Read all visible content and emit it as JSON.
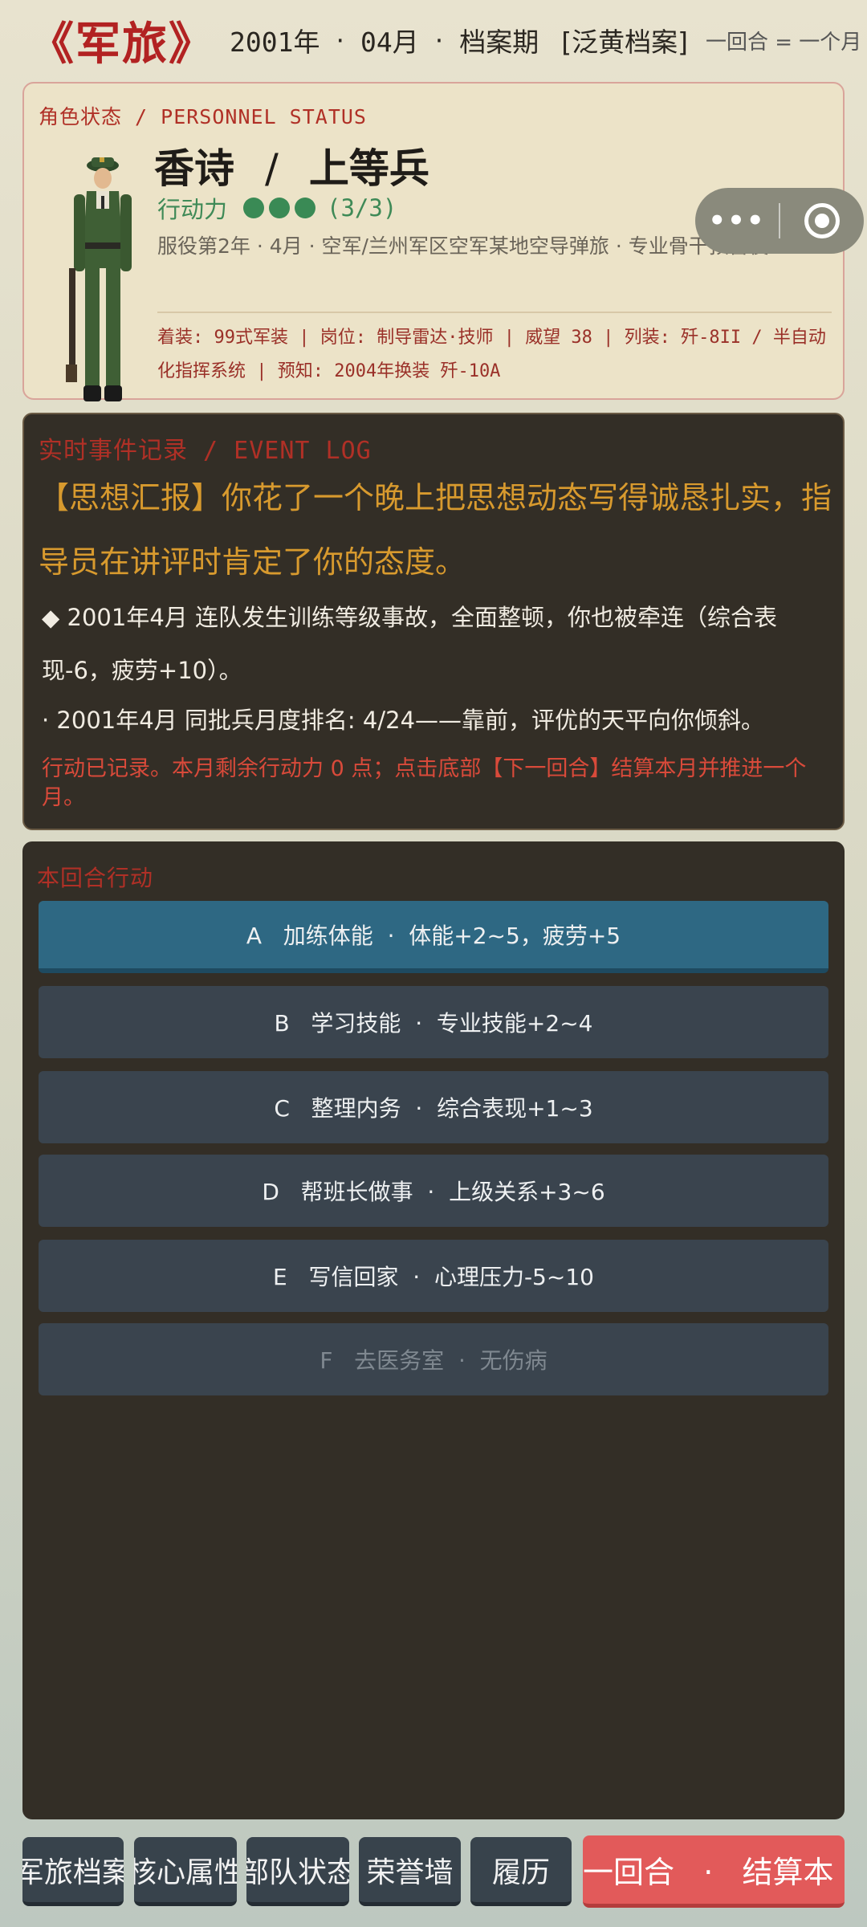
{
  "header": {
    "logo": "《军旅》",
    "year": "2001年",
    "month": "04月",
    "period": "档案期",
    "tag": "[泛黄档案]",
    "note": "一回合 = 一个月"
  },
  "status": {
    "section_title": "角色状态 / PERSONNEL STATUS",
    "name": "香诗",
    "rank": "上等兵",
    "ap_label": "行动力",
    "ap_count": "(3/3)",
    "ap_value": 3,
    "ap_max": 3,
    "service": "服役第2年 · 4月 · 空军/兰州军区空军某地空导弹旅 · 专业骨干预备役",
    "equipment": "着装: 99式军装 | 岗位: 制导雷达·技师 | 威望 38 | 列装: 歼-8II / 半自动化指挥系统 | 预知: 2004年换装 歼-10A",
    "colors": {
      "accent": "#b03026",
      "ap": "#3a8a55"
    }
  },
  "event_log": {
    "section_title": "实时事件记录 / EVENT LOG",
    "main": "【思想汇报】你花了一个晚上把思想动态写得诚恳扎实，指导员在讲评时肯定了你的态度。",
    "line1": "◆ 2001年4月 连队发生训练等级事故，全面整顿，你也被牵连（综合表现-6，疲劳+10）。",
    "line2": "· 2001年4月 同批兵月度排名: 4/24——靠前，评优的天平向你倾斜。",
    "note": "行动已记录。本月剩余行动力 0 点；点击底部【下一回合】结算本月并推进一个月。"
  },
  "actions": {
    "section_title": "本回合行动",
    "items": [
      {
        "label": "A   加练体能  ·  体能+2~5，疲劳+5"
      },
      {
        "label": "B   学习技能  ·  专业技能+2~4"
      },
      {
        "label": "C   整理内务  ·  综合表现+1~3"
      },
      {
        "label": "D   帮班长做事  ·  上级关系+3~6"
      },
      {
        "label": "E   写信回家  ·  心理压力-5~10"
      },
      {
        "label": "F   去医务室  ·  无伤病"
      }
    ]
  },
  "tabs": {
    "archive": "军旅档案",
    "attributes": "核心属性",
    "unit": "部队状态",
    "honor": "荣誉墙",
    "resume": "履历",
    "next": "一回合   ·   结算本"
  }
}
